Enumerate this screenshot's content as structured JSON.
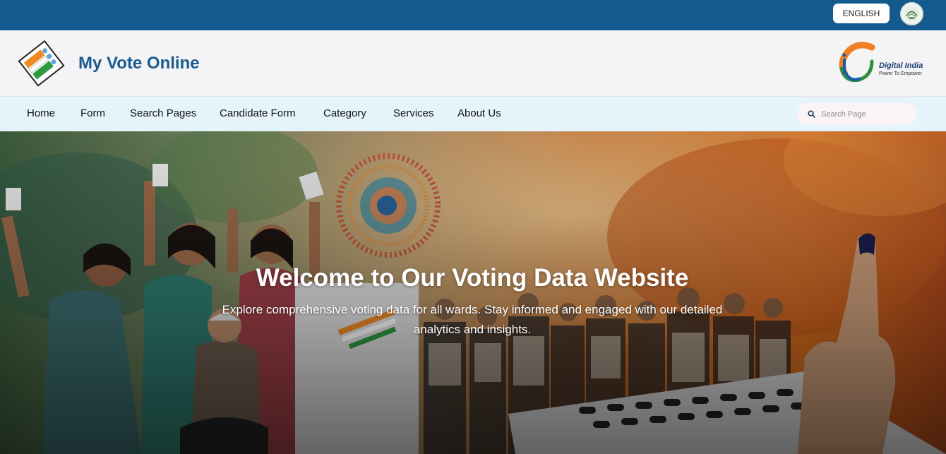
{
  "topbar": {
    "language_label": "ENGLISH"
  },
  "header": {
    "site_title": "My Vote Online",
    "partner_logo": {
      "title": "Digital India",
      "tagline": "Power To Empower"
    }
  },
  "nav": {
    "items": [
      {
        "label": "Home"
      },
      {
        "label": "Form"
      },
      {
        "label": "Search Pages"
      },
      {
        "label": "Candidate Form"
      },
      {
        "label": "Category"
      },
      {
        "label": "Services"
      },
      {
        "label": "About Us"
      }
    ],
    "search": {
      "placeholder": "Search Page",
      "icon": "search-icon"
    }
  },
  "hero": {
    "title": "Welcome to Our Voting Data Website",
    "subtitle": "Explore comprehensive voting data for all wards. Stay informed and engaged with our detailed analytics and insights."
  },
  "colors": {
    "topbar": "#155a8f",
    "title_blue": "#1a5a8d",
    "nav_bg": "#e5f4fb",
    "header_bg": "#f4f4f6"
  }
}
